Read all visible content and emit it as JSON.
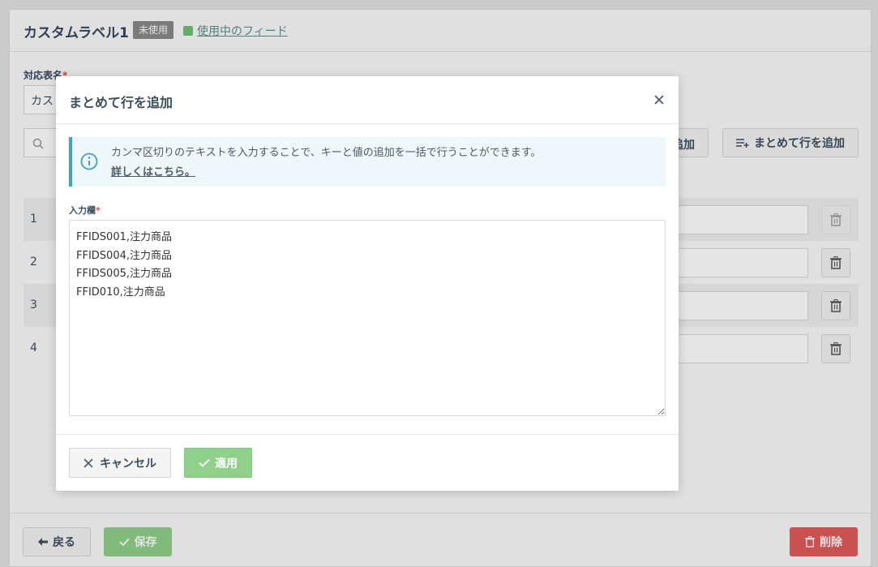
{
  "page": {
    "title": "カスタムラベル1",
    "status_badge": "未使用",
    "feed_link": "使用中のフィード",
    "mapping_label": "対応表名",
    "mapping_value": "カス",
    "add_row_label": "追加",
    "bulk_add_label": "まとめて行を追加",
    "rows": [
      {
        "num": "1"
      },
      {
        "num": "2"
      },
      {
        "num": "3"
      },
      {
        "num": "4"
      }
    ],
    "back_label": "戻る",
    "save_label": "保存",
    "delete_label": "削除"
  },
  "modal": {
    "title": "まとめて行を追加",
    "info_text": "カンマ区切りのテキストを入力することで、キーと値の追加を一括で行うことができます。",
    "info_link": "詳しくはこちら。",
    "input_label": "入力欄",
    "input_value": "FFIDS001,注力商品\nFFIDS004,注力商品\nFFIDS005,注力商品\nFFID010,注力商品",
    "cancel_label": "キャンセル",
    "apply_label": "適用"
  },
  "colors": {
    "accent_info": "#3ba3c5",
    "success": "#8fd18a",
    "danger": "#e35a5a",
    "required": "#e04a4a"
  }
}
